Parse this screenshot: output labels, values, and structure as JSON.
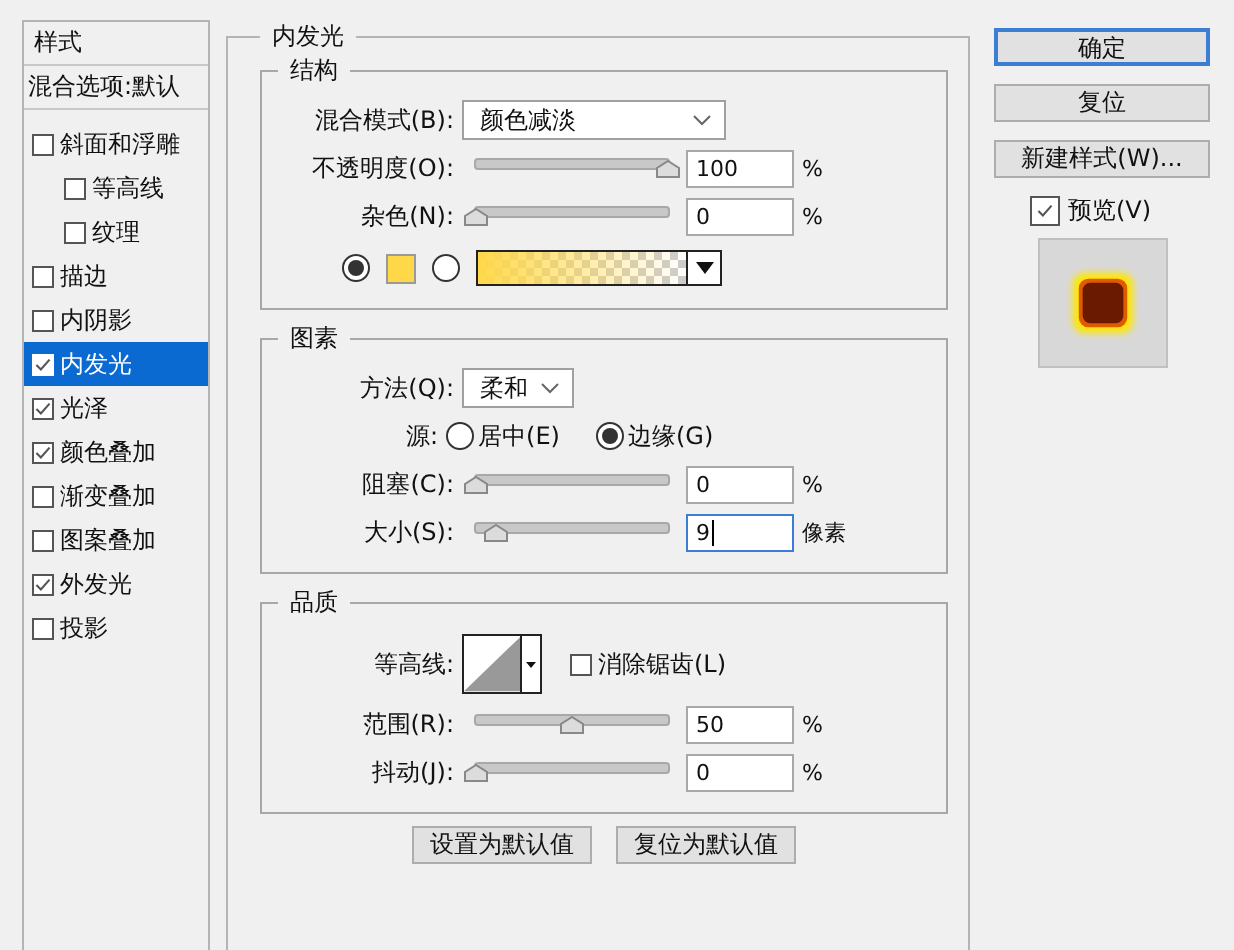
{
  "sidebar": {
    "header": "样式",
    "blend_options": "混合选项:默认",
    "items": [
      {
        "label": "斜面和浮雕",
        "checked": false,
        "selected": false,
        "children": [
          {
            "label": "等高线",
            "checked": false,
            "selected": false
          },
          {
            "label": "纹理",
            "checked": false,
            "selected": false
          }
        ]
      },
      {
        "label": "描边",
        "checked": false,
        "selected": false
      },
      {
        "label": "内阴影",
        "checked": false,
        "selected": false
      },
      {
        "label": "内发光",
        "checked": true,
        "selected": true
      },
      {
        "label": "光泽",
        "checked": true,
        "selected": false
      },
      {
        "label": "颜色叠加",
        "checked": true,
        "selected": false
      },
      {
        "label": "渐变叠加",
        "checked": false,
        "selected": false
      },
      {
        "label": "图案叠加",
        "checked": false,
        "selected": false
      },
      {
        "label": "外发光",
        "checked": true,
        "selected": false
      },
      {
        "label": "投影",
        "checked": false,
        "selected": false
      }
    ]
  },
  "panel": {
    "title": "内发光",
    "structure": {
      "title": "结构",
      "blend_mode": {
        "label": "混合模式(B):",
        "value": "颜色减淡"
      },
      "sliders": [
        {
          "label": "不透明度(O):",
          "level": 1,
          "value": "100",
          "unit": "%",
          "focused": false
        },
        {
          "label": "杂色(N):",
          "level": 0,
          "value": "0",
          "unit": "%",
          "focused": false
        }
      ],
      "fill_options": [
        {
          "kind": "color",
          "selected": true,
          "color": "#ffd84a"
        },
        {
          "kind": "gradient",
          "selected": false,
          "color": "#ffd84a"
        }
      ]
    },
    "elements": {
      "title": "图素",
      "technique": {
        "label": "方法(Q):",
        "value": "柔和"
      },
      "source": {
        "label": "源:",
        "options": [
          {
            "label": "居中(E)",
            "selected": false
          },
          {
            "label": "边缘(G)",
            "selected": true
          }
        ]
      },
      "sliders": [
        {
          "label": "阻塞(C):",
          "level": 0,
          "value": "0",
          "unit": "%",
          "focused": false
        },
        {
          "label": "大小(S):",
          "level": 0.1,
          "value": "9",
          "unit": "像素",
          "focused": true
        }
      ]
    },
    "quality": {
      "title": "品质",
      "contour": {
        "label": "等高线:"
      },
      "anti_alias": {
        "label": "消除锯齿(L)",
        "checked": false
      },
      "sliders": [
        {
          "label": "范围(R):",
          "level": 0.5,
          "value": "50",
          "unit": "%",
          "focused": false
        },
        {
          "label": "抖动(J):",
          "level": 0,
          "value": "0",
          "unit": "%",
          "focused": false
        }
      ]
    },
    "buttons": [
      "设置为默认值",
      "复位为默认值"
    ]
  },
  "actions": {
    "buttons": [
      {
        "label": "确定",
        "default": true
      },
      {
        "label": "复位",
        "default": false
      },
      {
        "label": "新建样式(W)...",
        "default": false
      }
    ],
    "preview": {
      "label": "预览(V)",
      "checked": true
    }
  }
}
